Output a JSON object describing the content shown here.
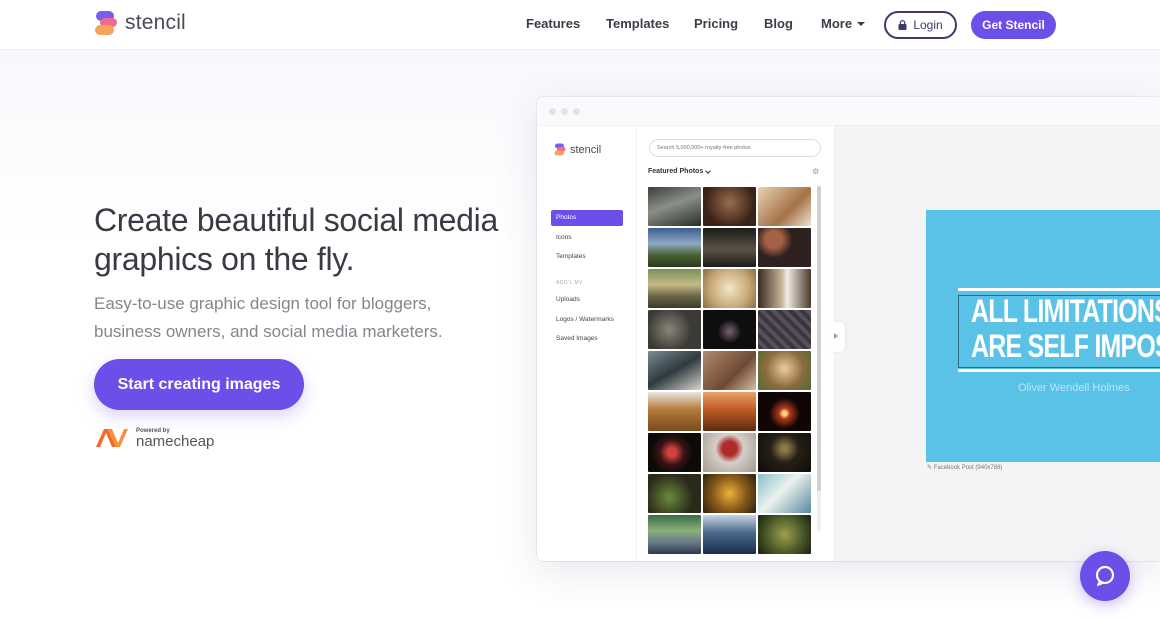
{
  "brand": {
    "name": "stencil"
  },
  "nav": {
    "links": [
      "Features",
      "Templates",
      "Pricing",
      "Blog",
      "More"
    ],
    "login_label": "Login",
    "cta_label": "Get Stencil"
  },
  "hero": {
    "title": "Create beautiful social media graphics on the fly.",
    "subtitle": "Easy-to-use graphic design tool for bloggers, business owners, and social media marketers.",
    "cta_label": "Start creating images",
    "powered_by": "Powered by",
    "partner": "namecheap"
  },
  "app": {
    "brand": "stencil",
    "search_placeholder": "Search 5,000,000+ royalty-free photos",
    "sidebar": {
      "items": [
        "Photos",
        "Icons",
        "Templates"
      ],
      "section_label": "ADD'L MY",
      "items2": [
        "Uploads",
        "Logos / Watermarks",
        "Saved Images"
      ]
    },
    "featured_label": "Featured Photos",
    "design": {
      "line1": "ALL LIMITATIONS",
      "line2": "ARE SELF IMPOSED",
      "author": "Oliver Wendell Holmes",
      "caption": "Facebook Post (940x788)"
    }
  },
  "colors": {
    "accent": "#6c4ee8",
    "design_bg": "#5bc2e7",
    "login_border": "#3b3a6e"
  },
  "icons": {
    "login": "lock-icon",
    "chat": "chat-bubble-icon",
    "settings": "gear-icon"
  }
}
